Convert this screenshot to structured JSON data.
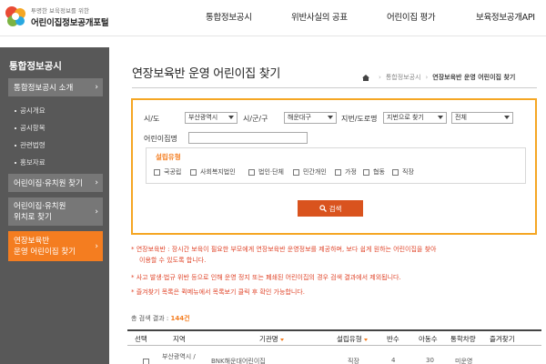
{
  "header": {
    "logo_sub": "투명한 보육정보를 위한",
    "logo_main": "어린이집정보공개포털",
    "logo_colors": [
      "#e94b35",
      "#f5a623",
      "#7cb342",
      "#29a8e0"
    ],
    "nav": [
      "통합정보공시",
      "위반사실의 공표",
      "어린이집 평가",
      "보육정보공개API"
    ]
  },
  "sidebar": {
    "title": "통합정보공시",
    "menu1": "통합정보공시 소개",
    "sub_items": [
      "공시개요",
      "공시항목",
      "관련법령",
      "홍보자료"
    ],
    "menu2": "어린이집·유치원 찾기",
    "menu3_line1": "어린이집·유치원",
    "menu3_line2": "위치로 찾기",
    "menu4_line1": "연장보육반",
    "menu4_line2": "운영 어린이집 찾기"
  },
  "page": {
    "title": "연장보육반 운영 어린이집 찾기",
    "breadcrumb": [
      "통합정보공시",
      "연장보육반 운영 어린이집 찾기"
    ]
  },
  "search": {
    "sido_label": "시/도",
    "sido_value": "부산광역시",
    "sigungu_label": "시/군/구",
    "sigungu_value": "해운대구",
    "road_label": "지번/도로명",
    "road_value": "지번으로 찾기",
    "road_sub_value": "전체",
    "name_label": "어린이집명",
    "name_value": "",
    "type_title": "설립유형",
    "types": [
      "국공립",
      "사회복지법인",
      "법인·단체",
      "민간개인",
      "가정",
      "협동",
      "직장"
    ],
    "button_label": "검색"
  },
  "notices": [
    "* 연장보육반 : 장시간 보육이 필요한 부모에게 연장보육반 운영정보를 제공하며, 보다 쉽게 원하는 어린이집을 찾아",
    "이용할 수 있도록 합니다.",
    "* 사고 발생·법규 위반 등으로 인해 운영 정지 또는 폐쇄된 어린이집의 경우 검색 결과에서 제외됩니다.",
    "* 즐겨찾기 목록은 퀵메뉴에서 목록보기 클릭 후 확인 가능합니다."
  ],
  "results": {
    "label": "총 검색 결과 : ",
    "count": "144건"
  },
  "table": {
    "headers": [
      "선택",
      "지역",
      "기관명",
      "설립유형",
      "반수",
      "아동수",
      "통학차량",
      "즐겨찾기"
    ],
    "first_row": {
      "region": "부산광역시 /",
      "name": "BNK해운대어린이집",
      "type": "직장",
      "classes": "4",
      "children": "30",
      "bus": "미운영"
    }
  }
}
